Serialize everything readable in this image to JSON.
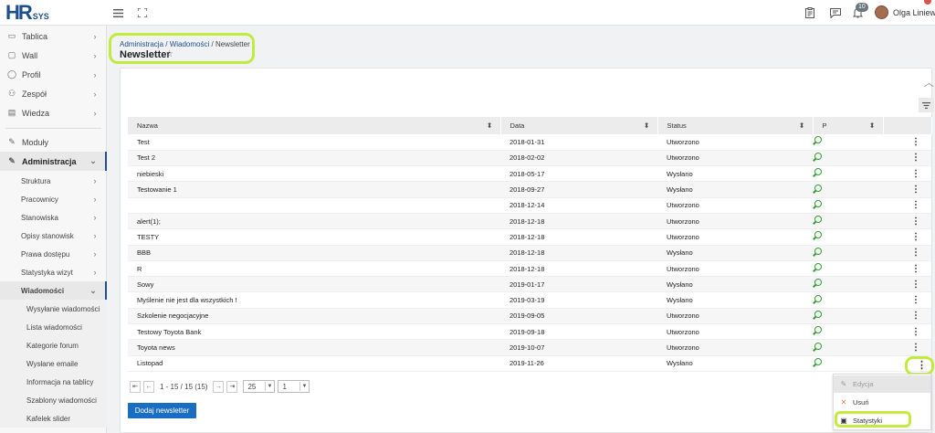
{
  "app": {
    "logo_main": "HR",
    "logo_sub": "SYS"
  },
  "topbar": {
    "notifications_count": "10",
    "user_name": "Olga Liniewicz"
  },
  "sidebar": {
    "items": [
      {
        "label": "Tablica",
        "icon": "monitor-icon"
      },
      {
        "label": "Wall",
        "icon": "chat-icon"
      },
      {
        "label": "Profil",
        "icon": "user-icon"
      },
      {
        "label": "Zespół",
        "icon": "team-icon"
      },
      {
        "label": "Wiedza",
        "icon": "book-icon"
      },
      {
        "label": "Moduły",
        "icon": "wrench-icon"
      },
      {
        "label": "Administracja",
        "icon": "wrench-icon"
      }
    ],
    "admin_sub": [
      {
        "label": "Struktura"
      },
      {
        "label": "Pracownicy"
      },
      {
        "label": "Stanowiska"
      },
      {
        "label": "Opisy stanowisk"
      },
      {
        "label": "Prawa dostępu"
      },
      {
        "label": "Statystyka wizyt"
      },
      {
        "label": "Wiadomości"
      }
    ],
    "messages_sub": [
      {
        "label": "Wysyłanie wiadomości"
      },
      {
        "label": "Lista wiadomości"
      },
      {
        "label": "Kategorie forum"
      },
      {
        "label": "Wysłane emaile"
      },
      {
        "label": "Informacja na tablicy"
      },
      {
        "label": "Szablony wiadomości"
      },
      {
        "label": "Kafelek slider"
      }
    ]
  },
  "breadcrumb": {
    "part1": "Administracja",
    "sep1": " / ",
    "part2": "Wiadomości",
    "sep2": " / ",
    "current": "Newsletter"
  },
  "page": {
    "title": "Newsletter"
  },
  "table": {
    "headers": {
      "name": "Nazwa",
      "date": "Data",
      "status": "Status",
      "p": "P"
    },
    "rows": [
      {
        "name": "Test",
        "date": "2018-01-31",
        "status": "Utworzono"
      },
      {
        "name": "Test 2",
        "date": "2018-02-02",
        "status": "Utworzono"
      },
      {
        "name": "niebieski",
        "date": "2018-05-17",
        "status": "Wysłano"
      },
      {
        "name": "Testowanie 1",
        "date": "2018-09-27",
        "status": "Wysłano"
      },
      {
        "name": "",
        "date": "2018-12-14",
        "status": "Utworzono"
      },
      {
        "name": "alert(1);",
        "date": "2018-12-18",
        "status": "Utworzono"
      },
      {
        "name": "TESTY",
        "date": "2018-12-18",
        "status": "Utworzono"
      },
      {
        "name": "BBB",
        "date": "2018-12-18",
        "status": "Wysłano"
      },
      {
        "name": "R",
        "date": "2018-12-18",
        "status": "Utworzono"
      },
      {
        "name": "Sowy",
        "date": "2019-01-17",
        "status": "Wysłano"
      },
      {
        "name": "Myślenie nie jest dla wszystkich !",
        "date": "2019-03-19",
        "status": "Wysłano"
      },
      {
        "name": "Szkolenie negocjacyjne",
        "date": "2019-09-05",
        "status": "Utworzono"
      },
      {
        "name": "Testowy Toyota Bank",
        "date": "2019-09-18",
        "status": "Utworzono"
      },
      {
        "name": "Toyota news",
        "date": "2019-10-07",
        "status": "Utworzono"
      },
      {
        "name": "Listopad",
        "date": "2019-11-26",
        "status": "Wysłano"
      }
    ]
  },
  "pager": {
    "info": "1 - 15 / 15 (15)",
    "page_size": "25",
    "page": "1"
  },
  "actions": {
    "add_label": "Dodaj newsletter"
  },
  "menu": {
    "edit": "Edycja",
    "delete": "Usuń",
    "stats": "Statystyki"
  },
  "colors": {
    "brand": "#1f4e8c",
    "primary_button": "#1a6ec1",
    "highlight": "#c3ea3f",
    "search_icon": "#2e9e2e"
  }
}
